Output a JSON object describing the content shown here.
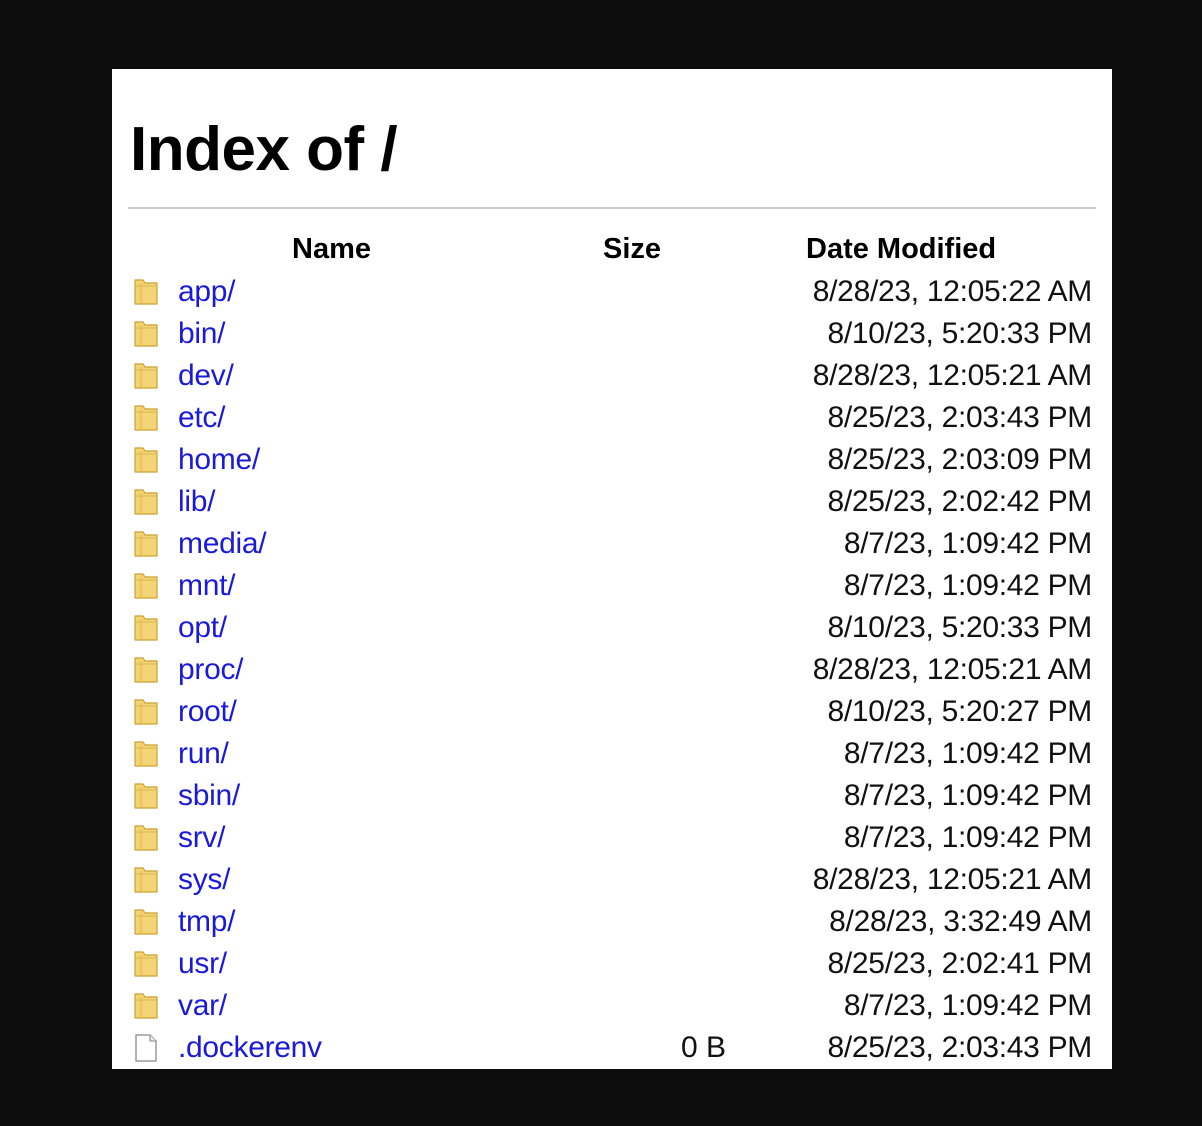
{
  "page": {
    "title": "Index of /"
  },
  "columns": {
    "name": "Name",
    "size": "Size",
    "date": "Date Modified"
  },
  "entries": [
    {
      "name": "app/",
      "size": "",
      "date": "8/28/23, 12:05:22 AM",
      "icon": "folder-icon"
    },
    {
      "name": "bin/",
      "size": "",
      "date": "8/10/23, 5:20:33 PM",
      "icon": "folder-icon"
    },
    {
      "name": "dev/",
      "size": "",
      "date": "8/28/23, 12:05:21 AM",
      "icon": "folder-icon"
    },
    {
      "name": "etc/",
      "size": "",
      "date": "8/25/23, 2:03:43 PM",
      "icon": "folder-icon"
    },
    {
      "name": "home/",
      "size": "",
      "date": "8/25/23, 2:03:09 PM",
      "icon": "folder-icon"
    },
    {
      "name": "lib/",
      "size": "",
      "date": "8/25/23, 2:02:42 PM",
      "icon": "folder-icon"
    },
    {
      "name": "media/",
      "size": "",
      "date": "8/7/23, 1:09:42 PM",
      "icon": "folder-icon"
    },
    {
      "name": "mnt/",
      "size": "",
      "date": "8/7/23, 1:09:42 PM",
      "icon": "folder-icon"
    },
    {
      "name": "opt/",
      "size": "",
      "date": "8/10/23, 5:20:33 PM",
      "icon": "folder-icon"
    },
    {
      "name": "proc/",
      "size": "",
      "date": "8/28/23, 12:05:21 AM",
      "icon": "folder-icon"
    },
    {
      "name": "root/",
      "size": "",
      "date": "8/10/23, 5:20:27 PM",
      "icon": "folder-icon"
    },
    {
      "name": "run/",
      "size": "",
      "date": "8/7/23, 1:09:42 PM",
      "icon": "folder-icon"
    },
    {
      "name": "sbin/",
      "size": "",
      "date": "8/7/23, 1:09:42 PM",
      "icon": "folder-icon"
    },
    {
      "name": "srv/",
      "size": "",
      "date": "8/7/23, 1:09:42 PM",
      "icon": "folder-icon"
    },
    {
      "name": "sys/",
      "size": "",
      "date": "8/28/23, 12:05:21 AM",
      "icon": "folder-icon"
    },
    {
      "name": "tmp/",
      "size": "",
      "date": "8/28/23, 3:32:49 AM",
      "icon": "folder-icon"
    },
    {
      "name": "usr/",
      "size": "",
      "date": "8/25/23, 2:02:41 PM",
      "icon": "folder-icon"
    },
    {
      "name": "var/",
      "size": "",
      "date": "8/7/23, 1:09:42 PM",
      "icon": "folder-icon"
    },
    {
      "name": ".dockerenv",
      "size": "0 B",
      "date": "8/25/23, 2:03:43 PM",
      "icon": "file-icon"
    }
  ],
  "colors": {
    "link": "#1a1adb",
    "backdrop": "#0d0d0d",
    "folder_fill": "#f3d577",
    "folder_edge": "#caa233"
  }
}
